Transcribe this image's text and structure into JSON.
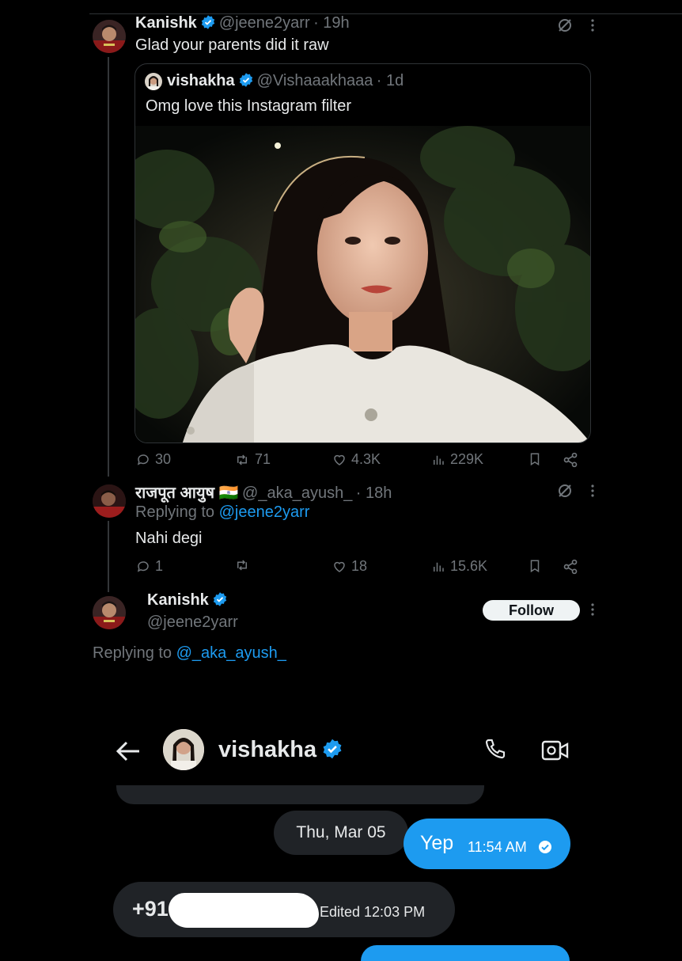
{
  "tweet_main": {
    "name": "Kanishk",
    "handle": "@jeene2yarr",
    "time": "· 19h",
    "text": "Glad your parents did it raw"
  },
  "quote": {
    "name": "vishakha",
    "handle": "@Vishaaakhaaa",
    "time": "· 1d",
    "text": "Omg love this Instagram filter"
  },
  "actions_main": {
    "replies": "30",
    "retweets": "71",
    "likes": "4.3K",
    "views": "229K"
  },
  "reply_tweet": {
    "name": "राजपूत आयुष 🇮🇳",
    "handle": "@_aka_ayush_",
    "time": "· 18h",
    "replying_prefix": "Replying to",
    "replying_handle": "@jeene2yarr",
    "text": "Nahi degi",
    "replies": "1",
    "retweets": "",
    "likes": "18",
    "views": "15.6K"
  },
  "focus_tweet": {
    "name": "Kanishk",
    "handle": "@jeene2yarr",
    "follow_label": "Follow",
    "replying_prefix": "Replying to",
    "replying_handle": "@_aka_ayush_"
  },
  "dm": {
    "contact_name": "vishakha",
    "date_chip": "Thu, Mar 05",
    "message_sent": "Yep",
    "message_sent_time": "11:54 AM",
    "message_received_prefix": "+91",
    "message_received_meta": "Edited 12:03 PM"
  },
  "colors": {
    "accent": "#1d9bf0",
    "background": "#000000",
    "muted": "#71767b"
  }
}
